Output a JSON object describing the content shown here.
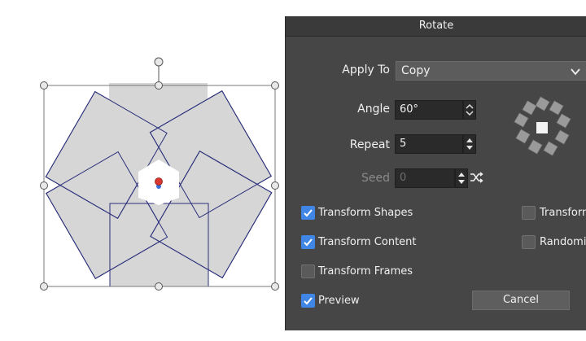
{
  "dialog": {
    "title": "Rotate",
    "apply_to": {
      "label": "Apply To",
      "value": "Copy"
    },
    "angle": {
      "label": "Angle",
      "value": "60°"
    },
    "repeat": {
      "label": "Repeat",
      "value": "5"
    },
    "seed": {
      "label": "Seed",
      "value": "0",
      "enabled": false
    },
    "options": {
      "transform_shapes": {
        "label": "Transform Shapes",
        "checked": true
      },
      "transform_content": {
        "label": "Transform Content",
        "checked": true
      },
      "transform_frames": {
        "label": "Transform Frames",
        "checked": false
      },
      "transform_right": {
        "label": "Transform",
        "checked": false
      },
      "randomize": {
        "label": "Randomi",
        "checked": false
      }
    },
    "preview": {
      "label": "Preview",
      "checked": true
    },
    "cancel_label": "Cancel"
  },
  "icons": {
    "dropdown": "chevron-down-icon",
    "spinner": "up-down-spinner-icon",
    "shuffle": "shuffle-icon",
    "rotate_preview": "rotate-preview-icon",
    "check": "checkmark-icon"
  },
  "colors": {
    "dialog_bg": "#464646",
    "shape_fill": "#d6d6d6",
    "shape_stroke": "#2b2f7a",
    "check_accent": "#3f86e6",
    "pivot_red": "#d8372f",
    "pivot_blue": "#3a6fd8"
  }
}
